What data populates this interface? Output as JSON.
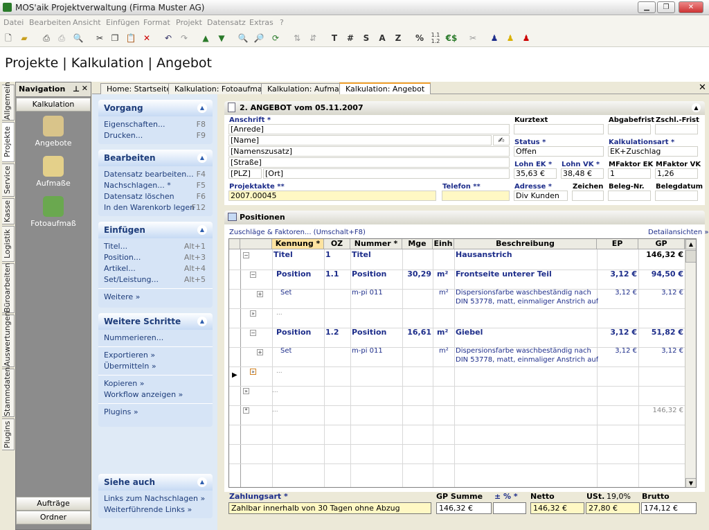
{
  "window": {
    "title": "MOS'aik Projektverwaltung (Firma Muster AG)"
  },
  "menu": [
    "Datei",
    "Bearbeiten",
    "Ansicht",
    "Einfügen",
    "Format",
    "Projekt",
    "Datensatz",
    "Extras",
    "?"
  ],
  "toolbar": {
    "t_label": "T",
    "hash_label": "#",
    "s_label": "S",
    "a_label": "A",
    "z_label": "Z",
    "percent_label": "%",
    "euro_label": "€$"
  },
  "header": {
    "title": "Projekte | Kalkulation | Angebot"
  },
  "vtabs": [
    "Allgemein",
    "Projekte",
    "Service",
    "Kasse",
    "Logistik",
    "Büroarbeiten",
    "Auswertungen",
    "Stammdaten",
    "Plugins"
  ],
  "nav": {
    "title": "Navigation",
    "category": "Kalkulation",
    "items": [
      "Angebote",
      "Aufmaße",
      "Fotoaufmaß"
    ],
    "bottom": [
      "Aufträge",
      "Ordner"
    ]
  },
  "doctabs": [
    "Home: Startseite",
    "Kalkulation: Fotoaufmaß",
    "Kalkulation: Aufmaß",
    "Kalkulation: Angebot"
  ],
  "taskpane": {
    "vorgang": {
      "title": "Vorgang",
      "links": [
        {
          "label": "Eigenschaften...",
          "key": "F8"
        },
        {
          "label": "Drucken...",
          "key": "F9"
        }
      ]
    },
    "bearbeiten": {
      "title": "Bearbeiten",
      "links": [
        {
          "label": "Datensatz bearbeiten...",
          "key": "F4"
        },
        {
          "label": "Nachschlagen... *",
          "key": "F5"
        },
        {
          "label": "Datensatz löschen",
          "key": "F6"
        },
        {
          "label": "In den Warenkorb legen",
          "key": "F12"
        }
      ]
    },
    "einfuegen": {
      "title": "Einfügen",
      "links": [
        {
          "label": "Titel...",
          "key": "Alt+1"
        },
        {
          "label": "Position...",
          "key": "Alt+3"
        },
        {
          "label": "Artikel...",
          "key": "Alt+4"
        },
        {
          "label": "Set/Leistung...",
          "key": "Alt+5"
        }
      ],
      "more": "Weitere »"
    },
    "schritte": {
      "title": "Weitere Schritte",
      "links": [
        "Nummerieren...",
        "Exportieren »",
        "Übermitteln »",
        "Kopieren »",
        "Workflow anzeigen »",
        "Plugins »"
      ]
    },
    "siehe": {
      "title": "Siehe auch",
      "links": [
        "Links zum Nachschlagen »",
        "Weiterführende Links »"
      ]
    }
  },
  "angebot": {
    "title": "2. ANGEBOT vom 05.11.2007",
    "anschrift_label": "Anschrift *",
    "anrede": "[Anrede]",
    "name": "[Name]",
    "namenszusatz": "[Namenszusatz]",
    "strasse": "[Straße]",
    "plz": "[PLZ]",
    "ort": "[Ort]",
    "kurztext_label": "Kurztext",
    "kurztext": "",
    "abgabefrist_label": "Abgabefrist",
    "zschl_label": "Zschl.-Frist",
    "status_label": "Status *",
    "status": "Offen",
    "kalkart_label": "Kalkulationsart *",
    "kalkart": "EK+Zuschlag",
    "lohn_ek_label": "Lohn EK *",
    "lohn_ek": "35,63 €",
    "lohn_vk_label": "Lohn VK *",
    "lohn_vk": "38,48 €",
    "mf_ek_label": "MFaktor EK",
    "mf_ek": "1",
    "mf_vk_label": "MFaktor VK",
    "mf_vk": "1,26",
    "projektakte_label": "Projektakte **",
    "projektakte": "2007.00045",
    "telefon_label": "Telefon **",
    "adresse_label": "Adresse *",
    "adresse": "Div Kunden",
    "zeichen_label": "Zeichen",
    "belegnr_label": "Beleg-Nr.",
    "belegdatum_label": "Belegdatum"
  },
  "positionen": {
    "title": "Positionen",
    "zuschlaege_link": "Zuschläge & Faktoren... (Umschalt+F8)",
    "details_link": "Detailansichten »",
    "columns": [
      "Kennung *",
      "OZ",
      "Nummer *",
      "Mge",
      "Einh",
      "Beschreibung",
      "EP",
      "GP"
    ],
    "rows": [
      {
        "kennung": "Titel",
        "oz": "1",
        "nummer": "Titel",
        "mge": "",
        "einh": "",
        "beschreibung": "Hausanstrich",
        "ep": "",
        "gp": "146,32 €"
      },
      {
        "kennung": "Position",
        "oz": "1.1",
        "nummer": "Position",
        "mge": "30,29",
        "einh": "m²",
        "beschreibung": "Frontseite unterer Teil",
        "ep": "3,12 €",
        "gp": "94,50 €"
      },
      {
        "kennung": "Set",
        "oz": "",
        "nummer": "m-pi 011",
        "mge": "",
        "einh": "m²",
        "beschreibung": "Dispersionsfarbe waschbeständig nach",
        "beschreibung2": "DIN 53778, matt, einmaliger Anstrich auf",
        "ep": "3,12 €",
        "gp": "3,12 €"
      },
      {
        "kennung": "...",
        "oz": "",
        "nummer": "",
        "mge": "",
        "einh": "",
        "beschreibung": "",
        "ep": "",
        "gp": ""
      },
      {
        "kennung": "Position",
        "oz": "1.2",
        "nummer": "Position",
        "mge": "16,61",
        "einh": "m²",
        "beschreibung": "Giebel",
        "ep": "3,12 €",
        "gp": "51,82 €"
      },
      {
        "kennung": "Set",
        "oz": "",
        "nummer": "m-pi 011",
        "mge": "",
        "einh": "m²",
        "beschreibung": "Dispersionsfarbe waschbeständig nach",
        "beschreibung2": "DIN 53778, matt, einmaliger Anstrich auf",
        "ep": "3,12 €",
        "gp": "3,12 €"
      },
      {
        "kennung": "...",
        "oz": "",
        "nummer": "",
        "mge": "",
        "einh": "",
        "beschreibung": "",
        "ep": "",
        "gp": ""
      },
      {
        "kennung": "...",
        "oz": "",
        "nummer": "",
        "mge": "",
        "einh": "",
        "beschreibung": "",
        "ep": "",
        "gp": ""
      },
      {
        "kennung": "...",
        "oz": "",
        "nummer": "",
        "mge": "",
        "einh": "",
        "beschreibung": "",
        "ep": "",
        "gp": "146,32 €"
      }
    ]
  },
  "footer": {
    "zahlungsart_label": "Zahlungsart *",
    "zahlungsart": "Zahlbar innerhalb von 30 Tagen ohne Abzug",
    "gp_summe_label": "GP Summe",
    "gp_summe": "146,32 €",
    "pct_label": "± % *",
    "pct": "",
    "netto_label": "Netto",
    "netto": "146,32 €",
    "ust_label": "USt.",
    "ust_rate": "19,0%",
    "ust": "27,80 €",
    "brutto_label": "Brutto",
    "brutto": "174,12 €"
  }
}
